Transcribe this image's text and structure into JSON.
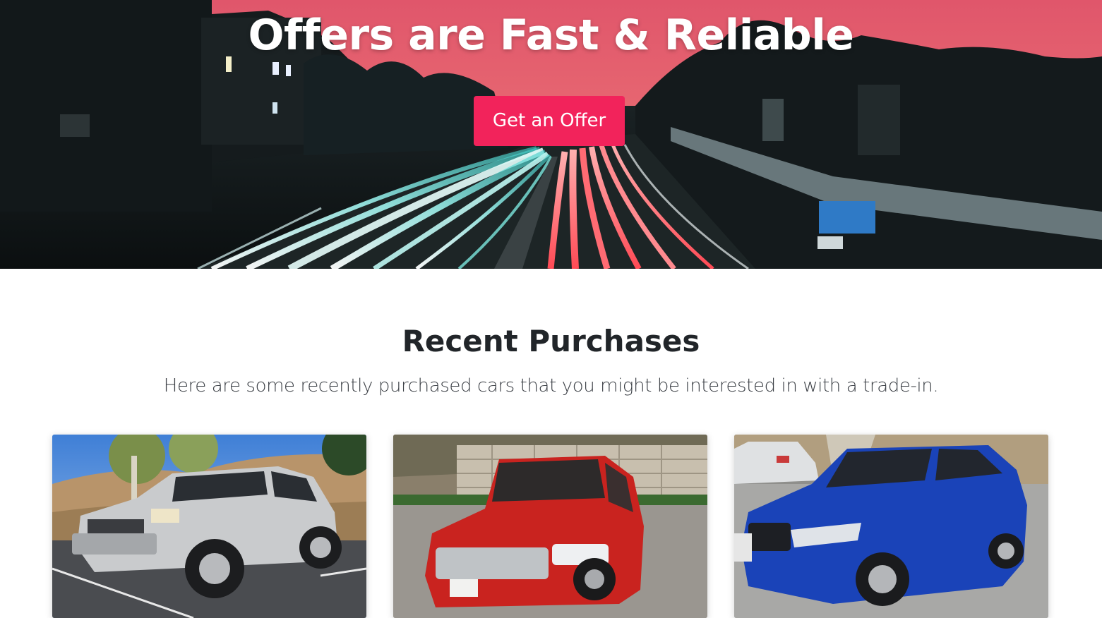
{
  "hero": {
    "title": "Offers are Fast & Reliable",
    "cta_label": "Get an Offer",
    "cta_color": "#f2235b",
    "background": "night highway long-exposure light trails under pink sunset sky"
  },
  "recent_purchases": {
    "title": "Recent Purchases",
    "subtitle": "Here are some recently purchased cars that you might be interested in with a trade-in.",
    "cars": [
      {
        "image": "silver SUV parked on hillside lot",
        "color": "#c9cbcd"
      },
      {
        "image": "red sedan parked in front of stone wall",
        "color": "#c9231f"
      },
      {
        "image": "blue sedan parked in lot",
        "color": "#1a43b8"
      }
    ]
  }
}
